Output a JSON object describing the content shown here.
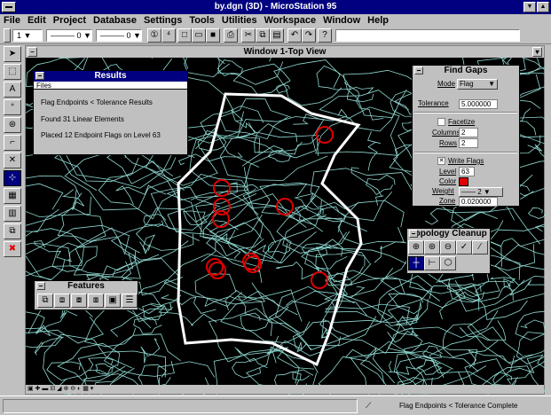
{
  "window": {
    "title": "by.dgn (3D) - MicroStation 95"
  },
  "menu": [
    "File",
    "Edit",
    "Project",
    "Database",
    "Settings",
    "Tools",
    "Utilities",
    "Workspace",
    "Window",
    "Help"
  ],
  "toolbar": {
    "level_value": "1",
    "line_value": "0",
    "weight_value": "0",
    "command_field": ""
  },
  "view": {
    "title": "Window 1-Top View"
  },
  "results": {
    "title": "Results",
    "menu": "Files",
    "lines": [
      "Flag Endpoints < Tolerance Results",
      "Found 31 Linear Elements",
      "Placed 12 Endpoint Flags on Level 63"
    ]
  },
  "findgaps": {
    "title": "Find Gaps",
    "mode_label": "Mode",
    "mode_value": "Flag",
    "tolerance_label": "Tolerance",
    "tolerance_value": "5.000000",
    "facetize_label": "Facetize",
    "columns_label": "Columns",
    "columns_value": "2",
    "rows_label": "Rows",
    "rows_value": "2",
    "writeflags_label": "Write Flags",
    "level_label": "Level",
    "level_value": "63",
    "color_label": "Color",
    "weight_label": "Weight",
    "weight_value": "2",
    "zone_label": "Zone",
    "zone_value": "0.020000",
    "colors": {
      "flag": "#e00000"
    }
  },
  "topology": {
    "title": "Topology Cleanup"
  },
  "features": {
    "title": "Features"
  },
  "status": {
    "message": "Flag Endpoints < Tolerance Complete"
  },
  "colors": {
    "titlebar": "#000080",
    "contour": "#8fd9d2",
    "boundary": "#ffffff",
    "flag": "#e00000"
  }
}
